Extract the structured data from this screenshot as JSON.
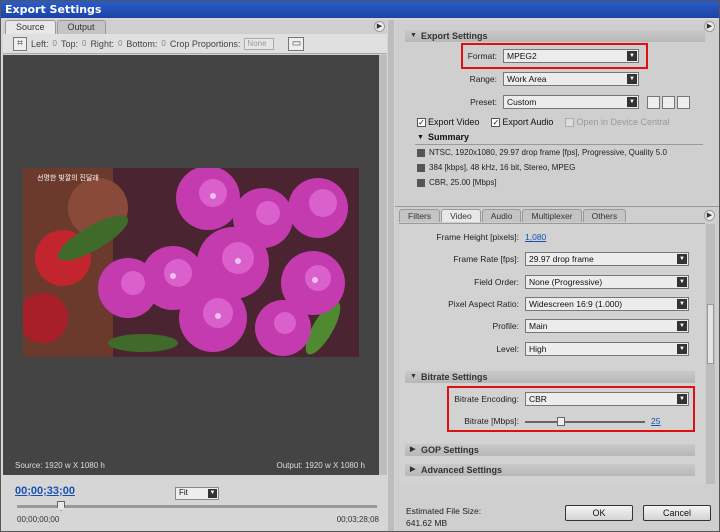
{
  "window": {
    "title": "Export Settings"
  },
  "left": {
    "tabs": [
      "Source",
      "Output"
    ],
    "toolbar": {
      "left": "Left:",
      "top": "Top:",
      "right": "Right:",
      "bottom": "Bottom:",
      "crop_proportions": "Crop Proportions:",
      "crop_value": "None"
    },
    "source_label": "Source: 1920 w X 1080 h",
    "output_label": "Output: 1920 w X 1080 h",
    "timecode": "00;00;33;00",
    "fit": "Fit",
    "time_start": "00;00;00;00",
    "time_end": "00;03;28;08",
    "overlay_text": "선명한 빛깔의 진달래"
  },
  "export": {
    "header": "Export Settings",
    "format_label": "Format:",
    "format_value": "MPEG2",
    "range_label": "Range:",
    "range_value": "Work Area",
    "preset_label": "Preset:",
    "preset_value": "Custom",
    "export_video": "Export Video",
    "export_audio": "Export Audio",
    "open_device": "Open in Device Central",
    "summary": "Summary",
    "summary_video": "NTSC, 1920x1080, 29.97 drop frame [fps], Progressive, Quality 5.0",
    "summary_audio": "384 [kbps], 48 kHz, 16 bit, Stereo, MPEG",
    "summary_bitrate": "CBR, 25.00 [Mbps]"
  },
  "tabs": [
    "Filters",
    "Video",
    "Audio",
    "Multiplexer",
    "Others"
  ],
  "video": {
    "frame_height_label": "Frame Height [pixels]:",
    "frame_height_value": "1,080",
    "frame_rate_label": "Frame Rate [fps]:",
    "frame_rate_value": "29.97 drop frame",
    "field_order_label": "Field Order:",
    "field_order_value": "None (Progressive)",
    "par_label": "Pixel Aspect Ratio:",
    "par_value": "Widescreen 16:9 (1.000)",
    "profile_label": "Profile:",
    "profile_value": "Main",
    "level_label": "Level:",
    "level_value": "High"
  },
  "bitrate": {
    "header": "Bitrate Settings",
    "encoding_label": "Bitrate Encoding:",
    "encoding_value": "CBR",
    "bitrate_label": "Bitrate [Mbps]:",
    "bitrate_value": "25",
    "slider_fraction": 0.3
  },
  "gop_header": "GOP Settings",
  "advanced_header": "Advanced Settings",
  "footer": {
    "size_label": "Estimated File Size:",
    "size_value": "641.62 MB",
    "ok": "OK",
    "cancel": "Cancel"
  },
  "colors": {
    "highlight": "#e01010",
    "link": "#1a4fb5",
    "titlebar": "#2a5cc8"
  }
}
